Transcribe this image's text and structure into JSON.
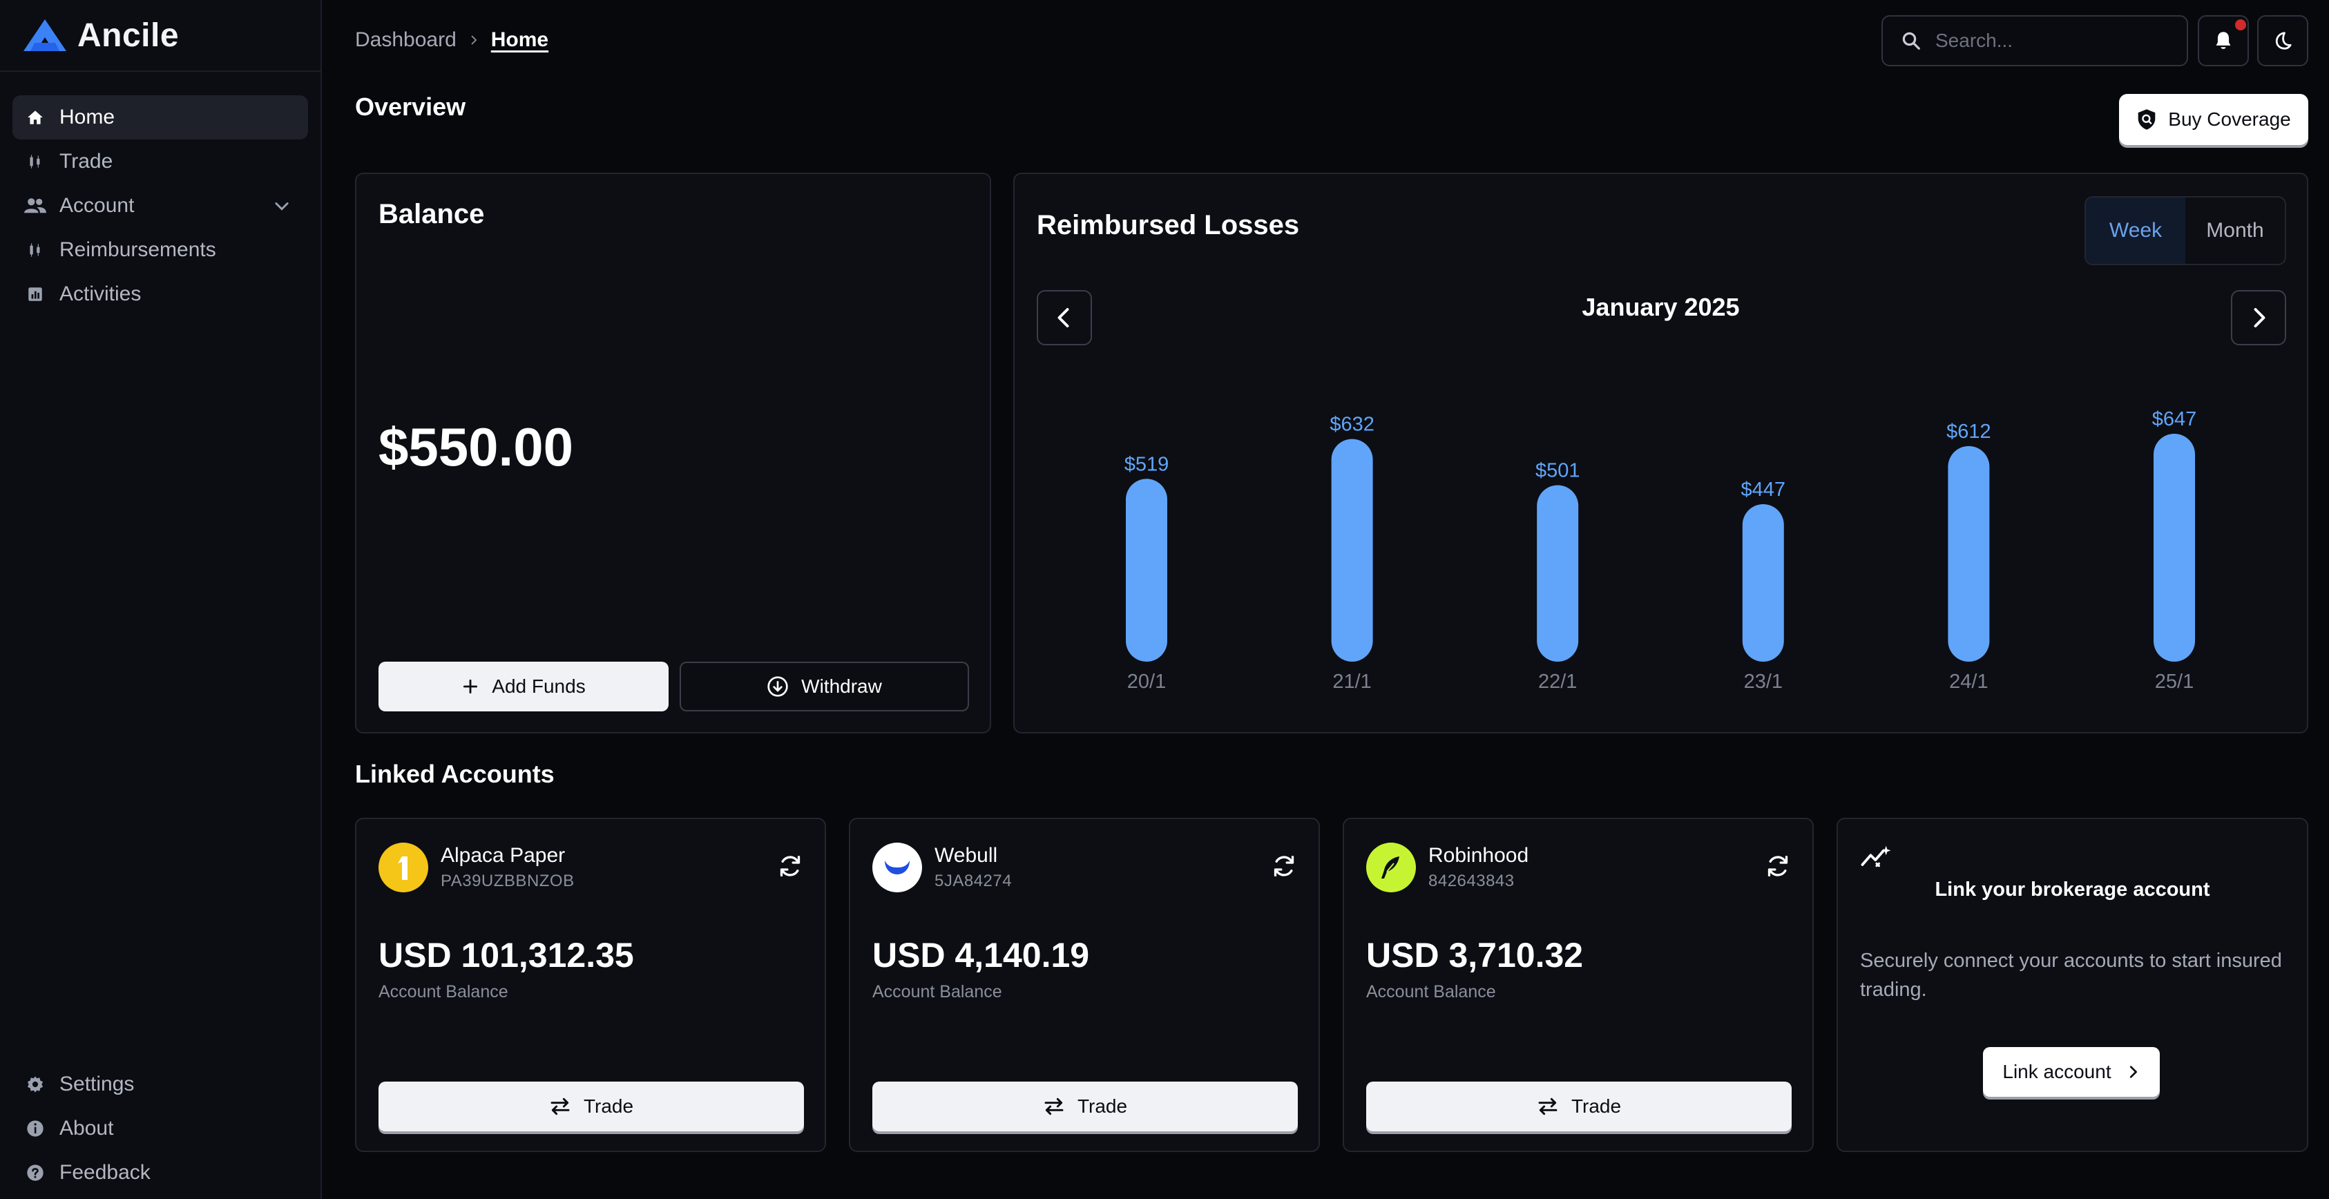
{
  "brand": {
    "name": "Ancile",
    "accent": "#3b82f6"
  },
  "sidebar": {
    "items": [
      {
        "label": "Home",
        "icon": "home-icon",
        "active": true
      },
      {
        "label": "Trade",
        "icon": "candlestick-icon"
      },
      {
        "label": "Account",
        "icon": "users-icon",
        "expandable": true
      },
      {
        "label": "Reimbursements",
        "icon": "candlestick-icon"
      },
      {
        "label": "Activities",
        "icon": "bar-chart-icon"
      }
    ],
    "bottom_items": [
      {
        "label": "Settings",
        "icon": "gear-icon"
      },
      {
        "label": "About",
        "icon": "info-icon"
      },
      {
        "label": "Feedback",
        "icon": "help-icon"
      }
    ]
  },
  "header": {
    "breadcrumb": [
      "Dashboard",
      "Home"
    ],
    "search_placeholder": "Search...",
    "notifications_badge": true,
    "theme_icon": "moon-icon"
  },
  "overview": {
    "title": "Overview",
    "buy_coverage_label": "Buy Coverage"
  },
  "balance": {
    "title": "Balance",
    "amount": "$550.00",
    "add_funds_label": "Add Funds",
    "withdraw_label": "Withdraw"
  },
  "losses": {
    "title": "Reimbursed Losses",
    "toggle": [
      "Week",
      "Month"
    ],
    "selected_toggle": "Week",
    "period_label": "January 2025"
  },
  "chart_data": {
    "type": "bar",
    "title": "Reimbursed Losses",
    "categories": [
      "20/1",
      "21/1",
      "22/1",
      "23/1",
      "24/1",
      "25/1"
    ],
    "values": [
      519,
      632,
      501,
      447,
      612,
      647
    ],
    "value_labels": [
      "$519",
      "$632",
      "$501",
      "$447",
      "$612",
      "$647"
    ],
    "bar_color": "#60a5fa",
    "ylim": [
      0,
      647
    ],
    "grid": false,
    "legend": "none"
  },
  "linked": {
    "title": "Linked Accounts",
    "accounts": [
      {
        "name": "Alpaca Paper",
        "id": "PA39UZBBNZOB",
        "balance": "USD 101,312.35",
        "balance_label": "Account Balance",
        "trade_label": "Trade",
        "logo_color": "#f5c518"
      },
      {
        "name": "Webull",
        "id": "5JA84274",
        "balance": "USD 4,140.19",
        "balance_label": "Account Balance",
        "trade_label": "Trade",
        "logo_color": "#ffffff"
      },
      {
        "name": "Robinhood",
        "id": "842643843",
        "balance": "USD 3,710.32",
        "balance_label": "Account Balance",
        "trade_label": "Trade",
        "logo_color": "#c6f432"
      }
    ],
    "link_card": {
      "title": "Link your brokerage account",
      "description": "Securely connect your accounts to start insured trading.",
      "button_label": "Link account"
    }
  }
}
